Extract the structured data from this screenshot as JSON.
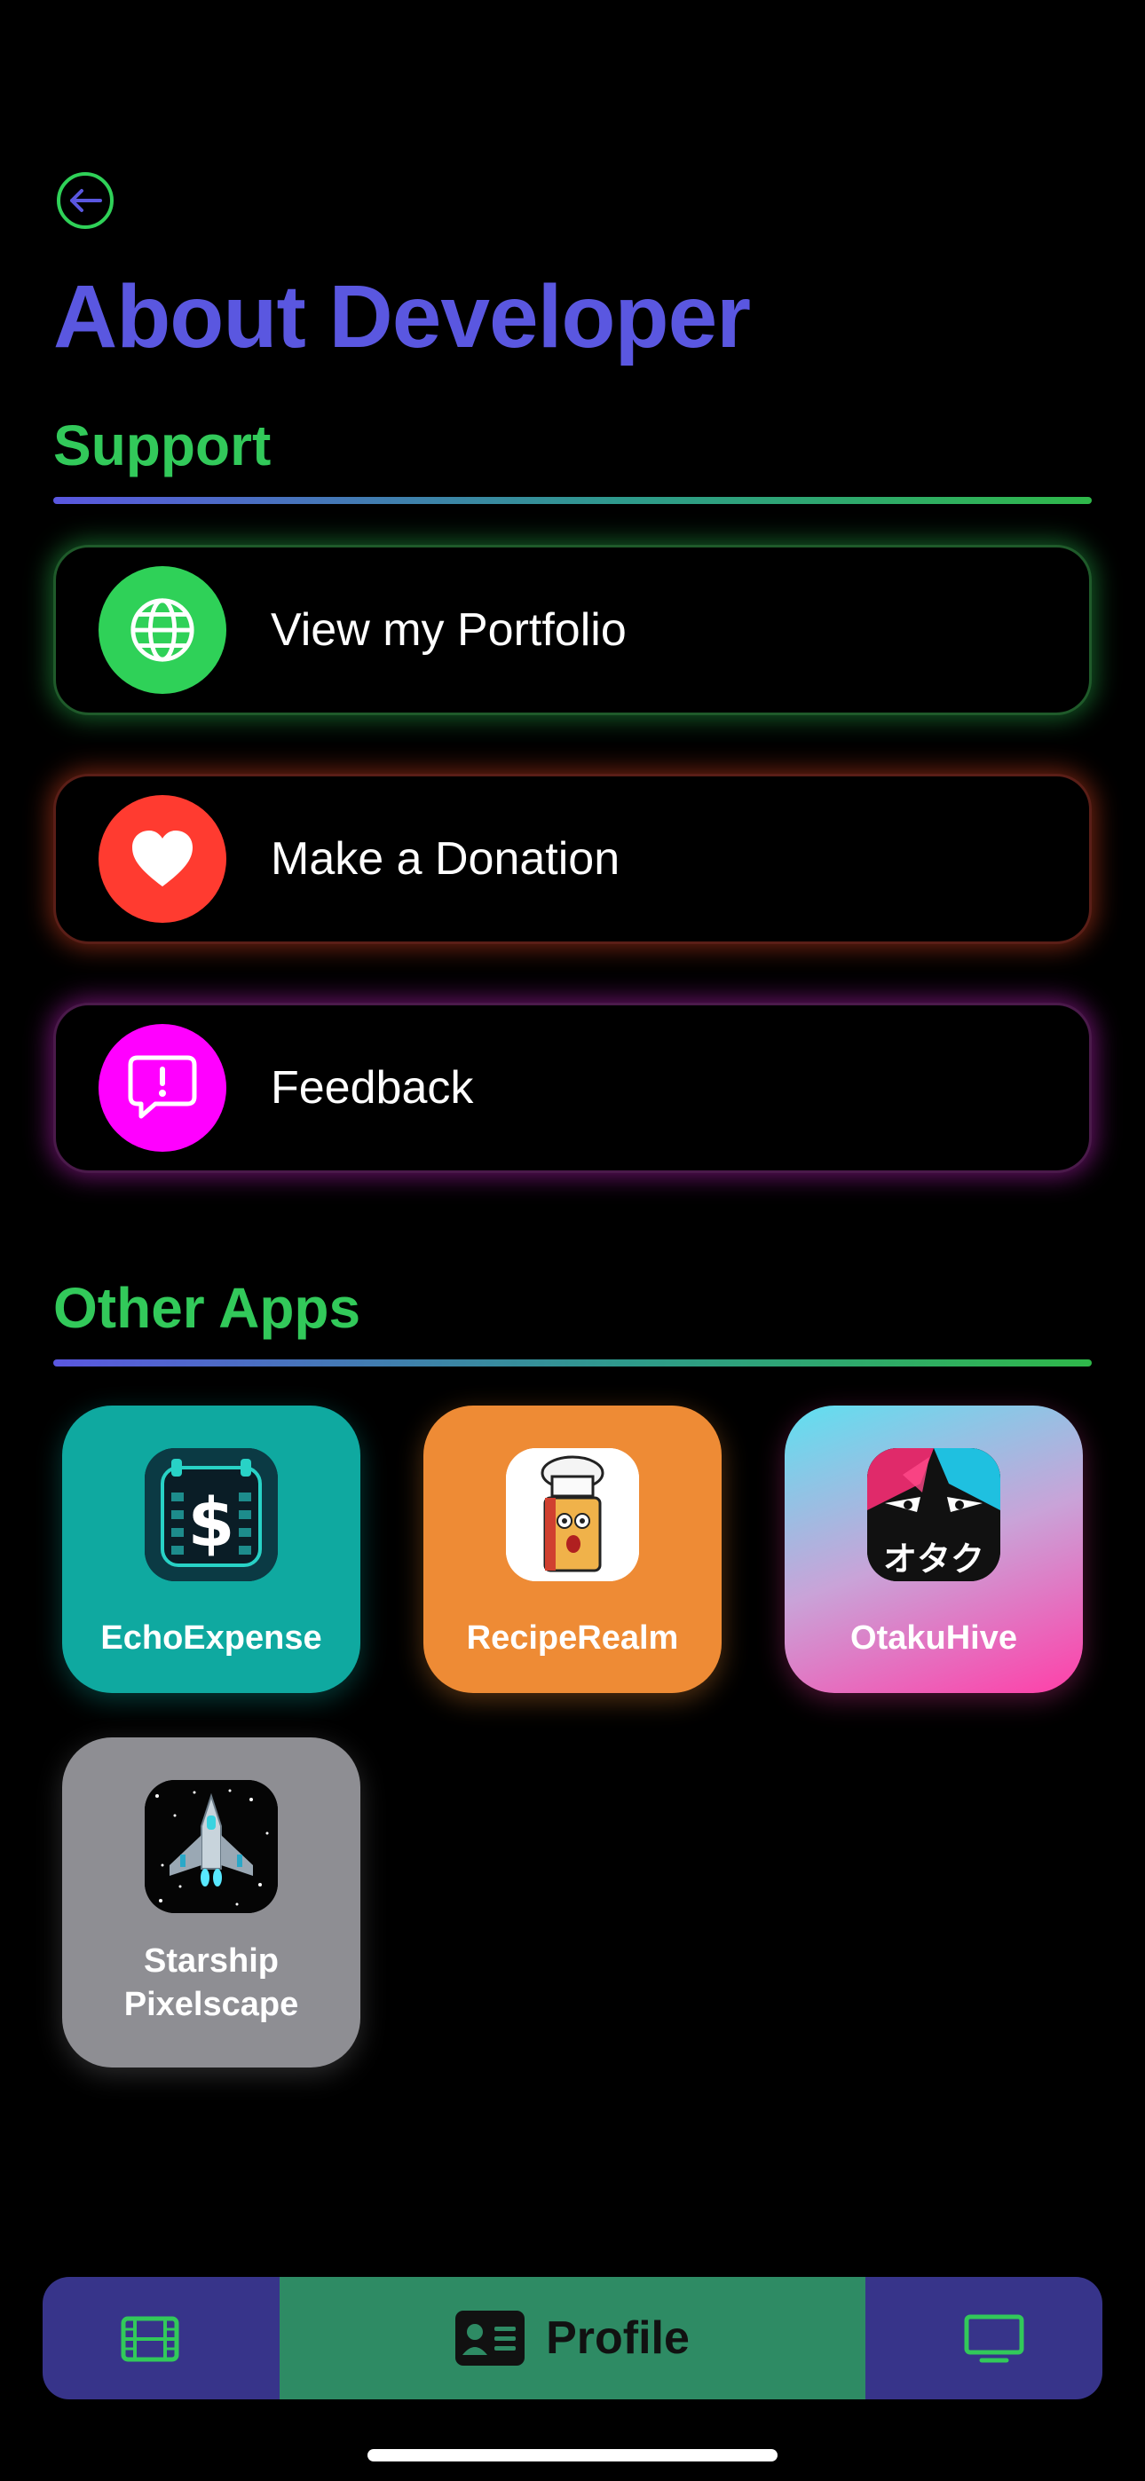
{
  "header": {
    "title": "About Developer"
  },
  "support": {
    "title": "Support",
    "items": [
      {
        "label": "View my Portfolio",
        "icon": "globe-icon",
        "color": "#2fd158"
      },
      {
        "label": "Make a Donation",
        "icon": "heart-icon",
        "color": "#ff3b30"
      },
      {
        "label": "Feedback",
        "icon": "feedback-bubble-icon",
        "color": "#ff00ff"
      }
    ]
  },
  "other_apps": {
    "title": "Other Apps",
    "apps": [
      {
        "name": "EchoExpense",
        "color": "#0fa9a0"
      },
      {
        "name": "RecipeRealm",
        "color": "#ee8b35"
      },
      {
        "name": "OtakuHive",
        "color": "#e45ab4"
      },
      {
        "name": "Starship Pixelscape",
        "color": "#8e8e93"
      }
    ]
  },
  "tabbar": {
    "active_label": "Profile",
    "tabs": [
      {
        "icon": "film-icon"
      },
      {
        "icon": "profile-card-icon"
      },
      {
        "icon": "tv-icon"
      }
    ]
  },
  "colors": {
    "accent": "#5a57e0",
    "section": "#32c95a"
  }
}
